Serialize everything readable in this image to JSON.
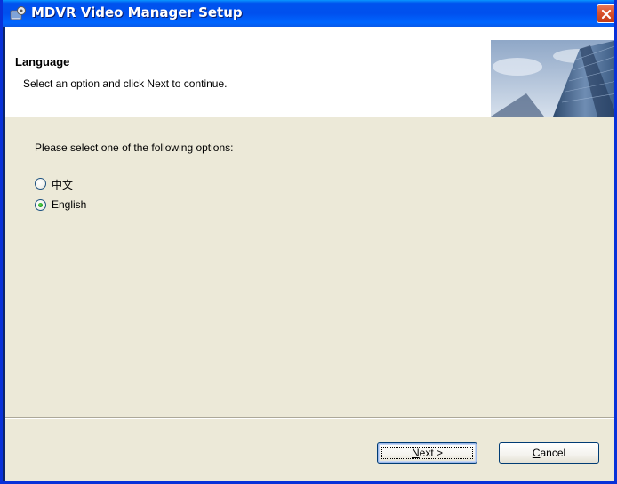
{
  "window": {
    "title": "MDVR Video Manager Setup",
    "icon": "setup-installer-icon",
    "close_icon": "close-icon"
  },
  "header": {
    "title": "Language",
    "subtitle": "Select an option and click Next to continue.",
    "image": "skyscraper-banner"
  },
  "body": {
    "prompt": "Please select one of the following options:",
    "options": [
      {
        "label": "中文",
        "selected": false
      },
      {
        "label": "English",
        "selected": true
      }
    ]
  },
  "buttons": {
    "next": {
      "mnemonic": "N",
      "rest": "ext >"
    },
    "cancel": {
      "mnemonic": "C",
      "rest": "ancel"
    }
  },
  "colors": {
    "titlebar": "#0053EE",
    "dialog_bg": "#ECE9D8",
    "radio_selected": "#22A51E"
  }
}
